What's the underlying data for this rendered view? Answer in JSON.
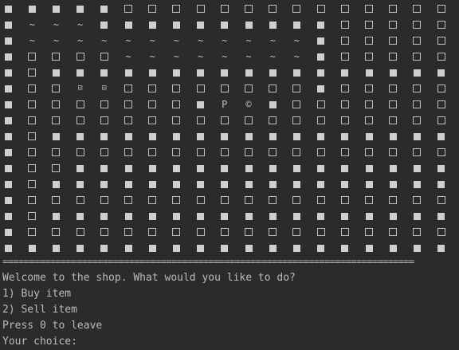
{
  "map": {
    "rows": [
      "F.F.F.F.F.E.E.E.E.E.E.E.E.E.E.E.E.E.E",
      "F.~.~.~.F.F.F.F.F.F.F.F.F.F.E.E.E.E.E",
      "F.~.~.~.~.~.~.~.~.~.~.~.~.F.E.E.E.E.E",
      "F.E.E.E.E.~.~.~.~.~.~.~.~.F.E.E.E.E.E",
      "F.E.F.F.F.F.F.F.F.F.F.F.F.F.F.F.F.F.F",
      "F.E.E.B.B.E.E.E.E.E.E.E.E.F.E.E.E.E.E",
      "F.E.E.E.E.E.E.E.F.P.C.F.E.E.E.E.E.E.E",
      "F.E.E.E.E.E.E.E.E.E.E.E.E.E.E.E.E.E.E",
      "F.E.F.F.F.F.F.F.F.F.F.F.F.F.F.F.F.F.F",
      "F.E.E.E.E.E.E.E.E.E.E.E.E.E.E.E.E.E.E",
      "F.E.E.F.F.F.F.F.F.F.F.F.F.F.F.F.F.F.F",
      "F.E.F.F.F.F.F.F.F.F.F.F.F.F.F.F.F.F.F",
      "F.E.E.E.E.E.E.E.E.E.E.E.E.E.E.E.E.E.E",
      "F.E.F.F.F.F.F.F.F.F.F.F.F.F.F.F.F.F.F",
      "F.E.E.E.E.E.E.E.E.E.E.E.E.E.E.E.E.E.E",
      "F.F.F.F.F.F.F.F.F.F.F.F.F.F.F.F.F.F.F"
    ],
    "symbols": {
      "F": {
        "name": "filled-square-icon",
        "kind": "filled"
      },
      "E": {
        "name": "empty-square-icon",
        "kind": "empty"
      },
      "~": {
        "name": "water-tile",
        "text": "~"
      },
      "B": {
        "name": "boxed-item-icon",
        "text": "⊡"
      },
      "P": {
        "name": "player-marker",
        "text": "P"
      },
      "C": {
        "name": "shopkeeper-marker",
        "text": "©"
      }
    }
  },
  "console": {
    "separator": "==============================================================================",
    "welcome": "Welcome to the shop. What would you like to do?",
    "option1": "1) Buy item",
    "option2": "2) Sell item",
    "leave": "Press 0 to leave",
    "prompt": "Your choice:"
  },
  "colors": {
    "background": "#2b2b2b",
    "text": "#bbbbbb"
  }
}
